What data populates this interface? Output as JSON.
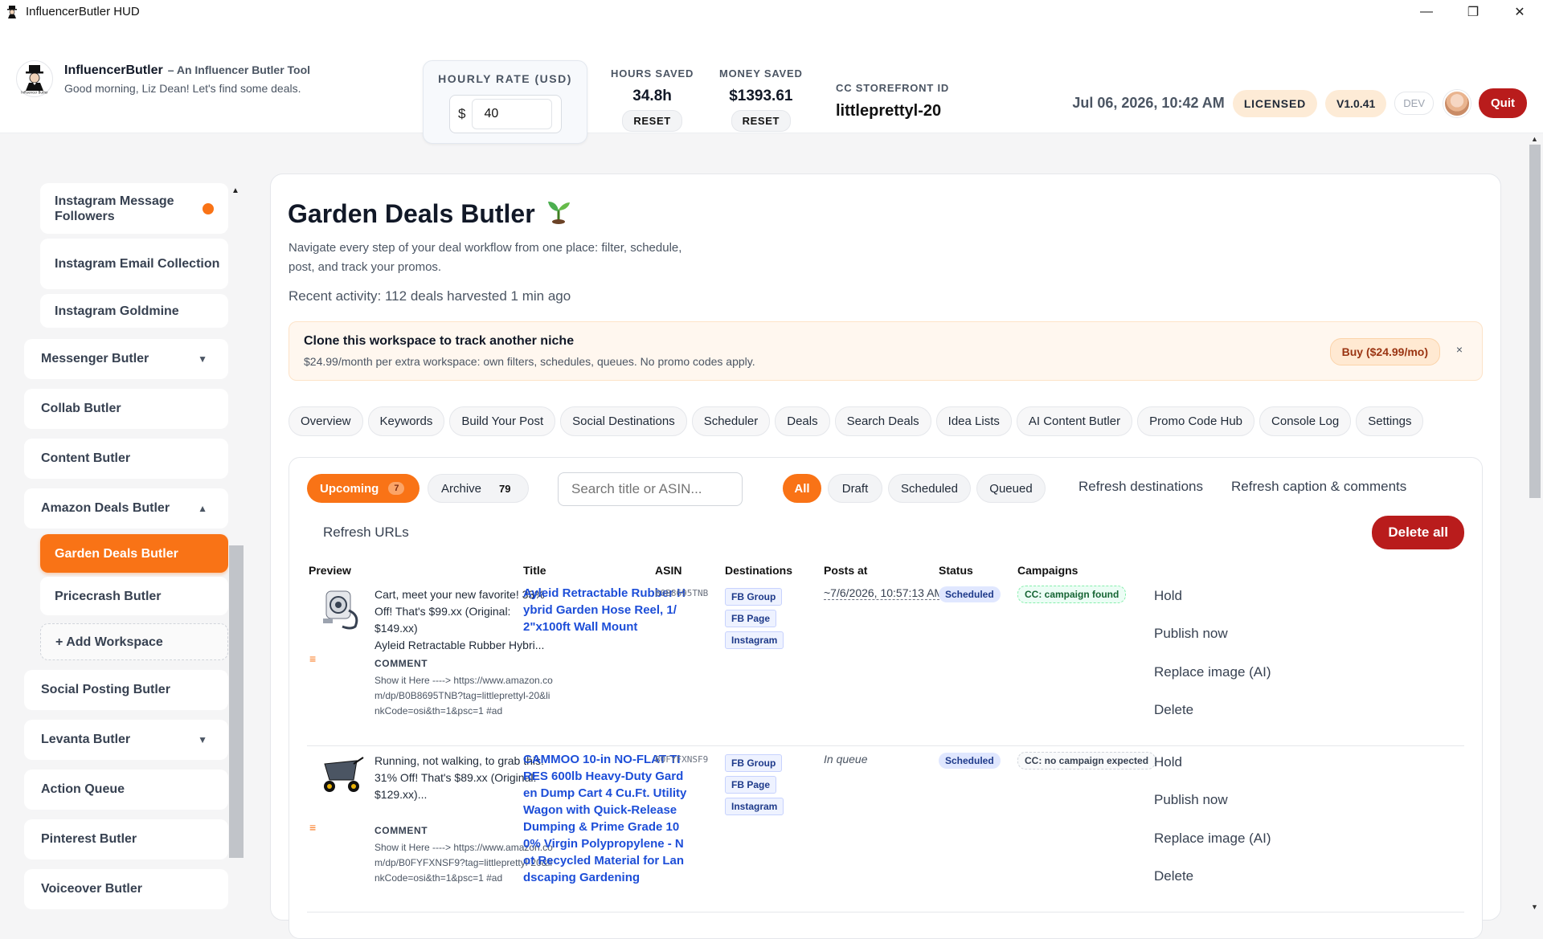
{
  "window": {
    "title": "InfluencerButler HUD",
    "minimize": "—",
    "maximize": "❐",
    "close": "✕"
  },
  "header": {
    "brand_name": "InfluencerButler",
    "brand_tag": "– An Influencer Butler Tool",
    "greeting": "Good morning, Liz Dean! Let's find some deals.",
    "hourly_rate_label": "HOURLY RATE (USD)",
    "currency_symbol": "$",
    "hourly_rate_value": "40",
    "hours_saved_label": "HOURS SAVED",
    "hours_saved_value": "34.8h",
    "money_saved_label": "MONEY SAVED",
    "money_saved_value": "$1393.61",
    "reset_label": "RESET",
    "cc_label": "CC STOREFRONT ID",
    "cc_value": "littleprettyl-20",
    "datetime": "Jul 06, 2026, 10:42 AM",
    "licensed": "LICENSED",
    "version": "V1.0.41",
    "dev": "DEV",
    "quit": "Quit"
  },
  "sidebar": {
    "sub_top": [
      {
        "label": "Instagram Message Followers",
        "dot": true
      },
      {
        "label": "Instagram Email Collection"
      },
      {
        "label": "Instagram Goldmine"
      }
    ],
    "messenger": "Messenger Butler",
    "collab": "Collab Butler",
    "content": "Content Butler",
    "amazon": "Amazon Deals Butler",
    "garden": "Garden Deals Butler",
    "pricecrash": "Pricecrash Butler",
    "add_workspace": "+ Add Workspace",
    "social": "Social Posting Butler",
    "levanta": "Levanta Butler",
    "action_queue": "Action Queue",
    "pinterest": "Pinterest Butler",
    "voiceover": "Voiceover Butler"
  },
  "main": {
    "title": "Garden Deals Butler",
    "description": "Navigate every step of your deal workflow from one place: filter, schedule, post, and track your promos.",
    "recent": "Recent activity: 112 deals harvested 1 min ago",
    "banner_title": "Clone this workspace to track another niche",
    "banner_sub": "$24.99/month per extra workspace: own filters, schedules, queues. No promo codes apply.",
    "banner_buy": "Buy ($24.99/mo)",
    "banner_close": "×",
    "tabs": [
      "Overview",
      "Keywords",
      "Build Your Post",
      "Social Destinations",
      "Scheduler",
      "Deals",
      "Search Deals",
      "Idea Lists",
      "AI Content Butler",
      "Promo Code Hub",
      "Console Log",
      "Settings"
    ]
  },
  "deals": {
    "upcoming_label": "Upcoming",
    "upcoming_count": "7",
    "archive_label": "Archive",
    "archive_count": "79",
    "search_placeholder": "Search title or ASIN...",
    "filter_all": "All",
    "filter_draft": "Draft",
    "filter_scheduled": "Scheduled",
    "filter_queued": "Queued",
    "refresh_destinations": "Refresh destinations",
    "refresh_caption": "Refresh caption & comments",
    "refresh_urls": "Refresh URLs",
    "delete_all": "Delete all",
    "columns": {
      "preview": "Preview",
      "title": "Title",
      "asin": "ASIN",
      "destinations": "Destinations",
      "posts_at": "Posts at",
      "status": "Status",
      "campaigns": "Campaigns"
    },
    "comment_label": "COMMENT",
    "actions": {
      "hold": "Hold",
      "publish": "Publish now",
      "replace": "Replace image (AI)",
      "delete": "Delete"
    },
    "rows": [
      {
        "preview": "Cart, meet your new favorite! 33% Off! That's $99.xx (Original: $149.xx)",
        "preview_more": "Ayleid Retractable Rubber Hybri...",
        "comment": "Show it Here ----> https://www.amazon.com/dp/B0B8695TNB?tag=littleprettyl-20&linkCode=osi&th=1&psc=1 #ad",
        "title": "Ayleid Retractable Rubber Hybrid Garden Hose Reel, 1/2\"x100ft Wall Mount",
        "asin": "B0B8695TNB",
        "destinations": [
          "FB Group",
          "FB Page",
          "Instagram"
        ],
        "posts_at": "~7/6/2026, 10:57:13 AM",
        "status": "Scheduled",
        "campaign": "CC: campaign found"
      },
      {
        "preview": "Running, not walking, to grab this! 31% Off! That's $89.xx (Original: $129.xx)...",
        "comment": "Show it Here ----> https://www.amazon.com/dp/B0FYFXNSF9?tag=littleprettyl-20&linkCode=osi&th=1&psc=1 #ad",
        "title": "CAMMOO 10-in NO-FLAT TIRES 600lb Heavy-Duty Garden Dump Cart 4 Cu.Ft. Utility Wagon with Quick-Release Dumping & Prime Grade 100% Virgin Polypropylene - Not Recycled Material for Landscaping Gardening",
        "asin": "B0FYFXNSF9",
        "destinations": [
          "FB Group",
          "FB Page",
          "Instagram"
        ],
        "posts_at": "In queue",
        "status": "Scheduled",
        "campaign": "CC: no campaign expected"
      }
    ]
  },
  "colors": {
    "accent": "#f97316",
    "danger": "#b91c1c",
    "link": "#1d4ed8"
  }
}
